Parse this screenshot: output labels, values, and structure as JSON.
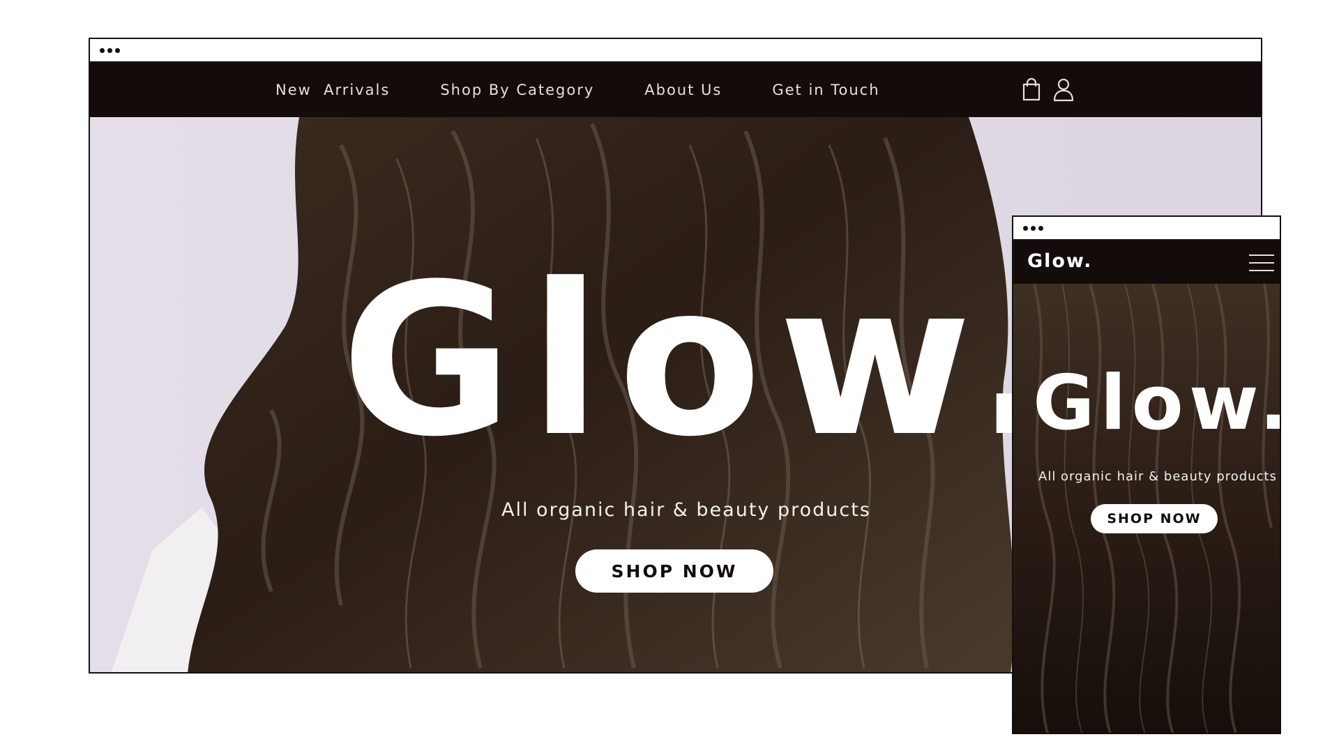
{
  "desktop": {
    "window_dots": [
      "dot",
      "dot",
      "dot"
    ],
    "nav": {
      "links": [
        {
          "label": "New  Arrivals"
        },
        {
          "label": "Shop By Category"
        },
        {
          "label": "About Us"
        },
        {
          "label": "Get in Touch"
        }
      ],
      "icons": [
        "shopping-bag-icon",
        "user-account-icon"
      ]
    },
    "hero": {
      "title": "Glow.",
      "subtitle": "All organic hair & beauty products",
      "cta_label": "SHOP NOW"
    }
  },
  "mobile": {
    "window_dots": [
      "dot",
      "dot",
      "dot"
    ],
    "nav": {
      "logo": "Glow.",
      "menu_icon": "hamburger-menu-icon"
    },
    "hero": {
      "title": "Glow.",
      "subtitle": "All organic hair & beauty products",
      "cta_label": "SHOP NOW"
    }
  },
  "colors": {
    "nav_background": "#140c0a",
    "hero_backdrop": "#e4dee8",
    "hair_dark": "#2a1d15",
    "hair_light": "#6b5a48",
    "button_background": "#ffffff",
    "button_text": "#120c0a",
    "text_light": "#ffffff"
  }
}
